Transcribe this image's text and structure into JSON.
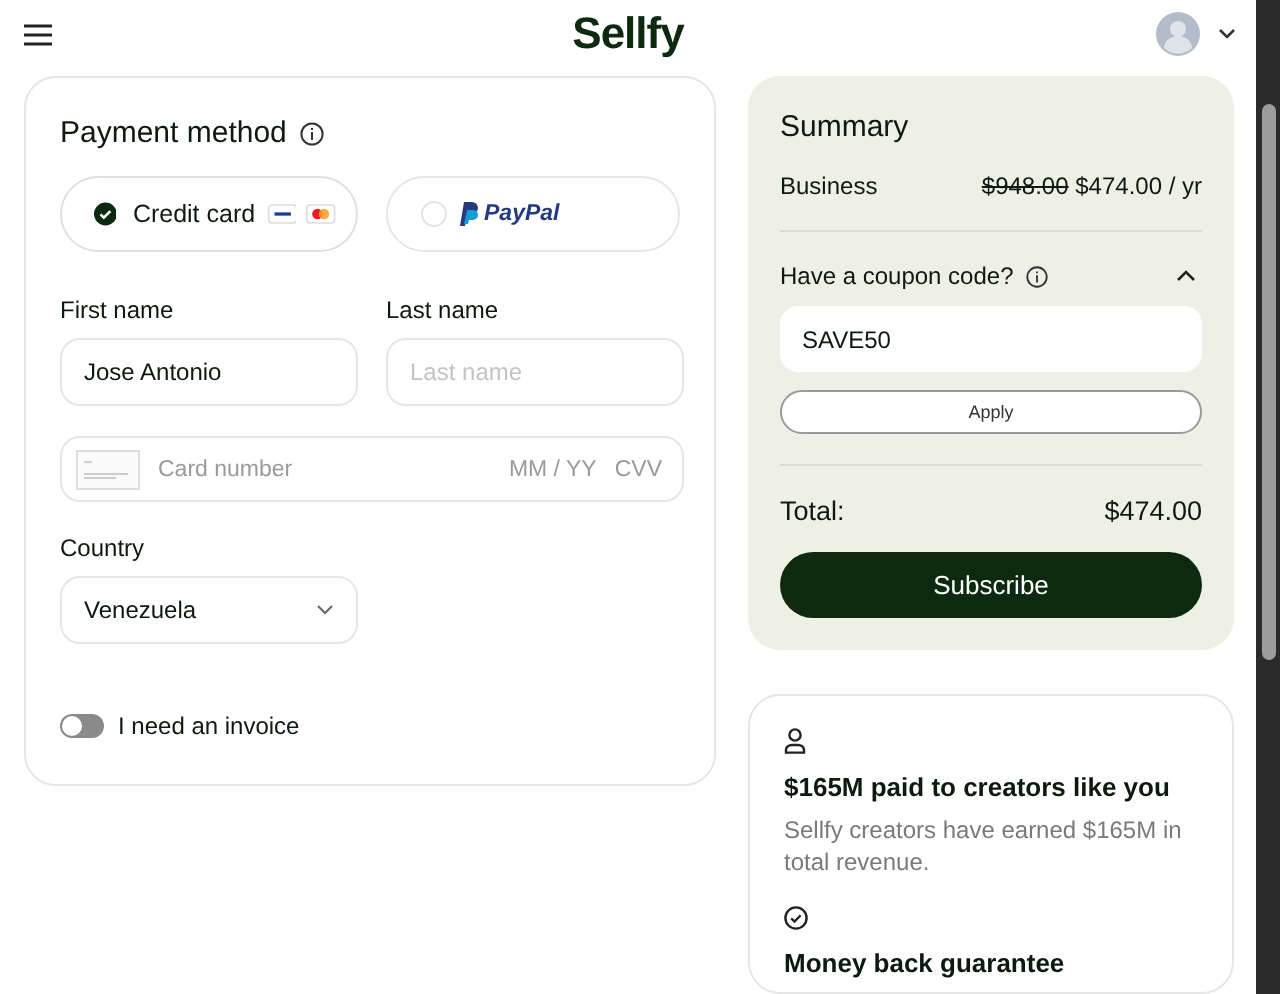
{
  "header": {
    "logo": "Sellfy"
  },
  "payment": {
    "title": "Payment method",
    "methods": [
      {
        "kind": "card",
        "label": "Credit card",
        "selected": true
      },
      {
        "kind": "paypal",
        "label": "PayPal",
        "selected": false
      }
    ],
    "first_name": {
      "label": "First name",
      "value": "Jose Antonio"
    },
    "last_name": {
      "label": "Last name",
      "placeholder": "Last name"
    },
    "card": {
      "placeholder": "Card number",
      "expiry_placeholder": "MM / YY",
      "cvv_placeholder": "CVV"
    },
    "country": {
      "label": "Country",
      "value": "Venezuela"
    },
    "invoice": {
      "label": "I need an invoice",
      "on": false
    }
  },
  "summary": {
    "title": "Summary",
    "plan": "Business",
    "old_price": "$948.00",
    "price": "$474.00 / yr",
    "coupon": {
      "label": "Have a coupon code?",
      "expanded": true,
      "value": "SAVE50",
      "button": "Apply"
    },
    "total_label": "Total:",
    "total": "$474.00",
    "subscribe": "Subscribe"
  },
  "trust": [
    {
      "kind": "person",
      "title": "$165M paid to creators like you",
      "text": "Sellfy creators have earned $165M in total revenue."
    },
    {
      "kind": "check",
      "title": "Money back guarantee"
    }
  ]
}
